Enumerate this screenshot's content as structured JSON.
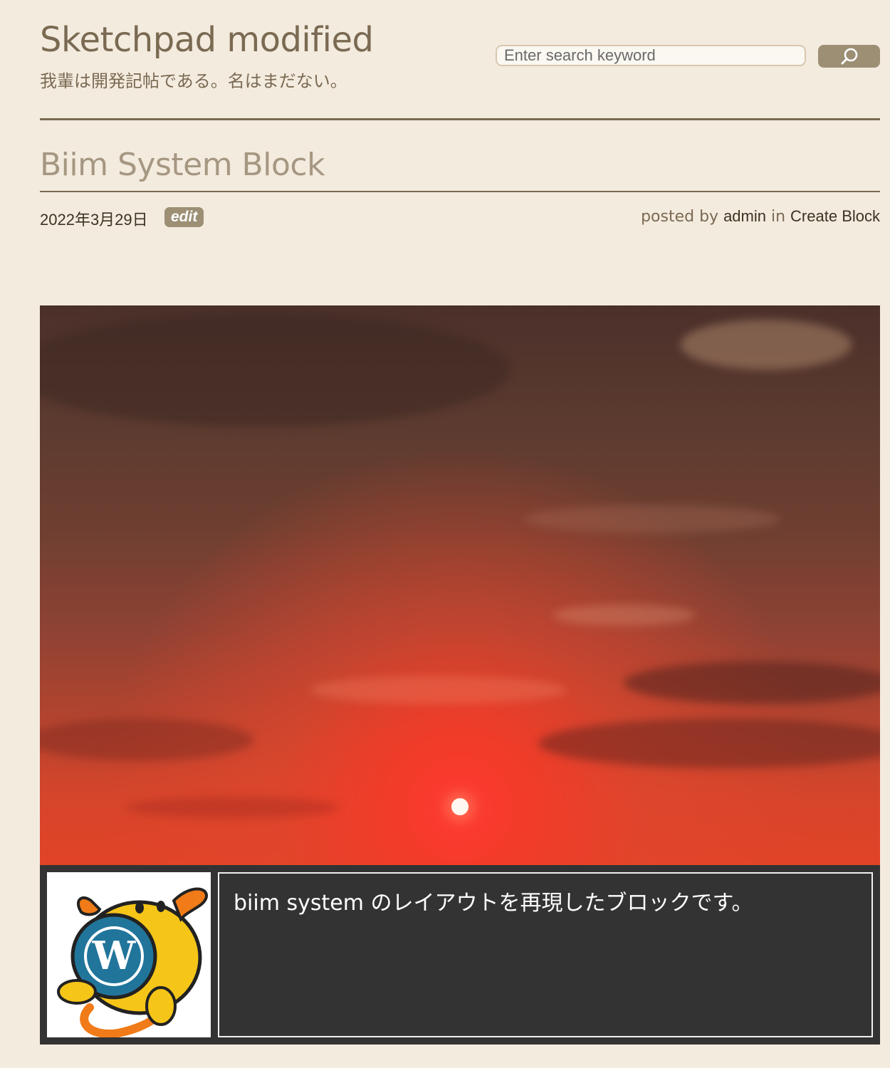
{
  "site": {
    "title": "Sketchpad modified",
    "tagline": "我輩は開発記帖である。名はまだない。"
  },
  "search": {
    "placeholder": "Enter search keyword",
    "button_icon": "search-icon"
  },
  "post": {
    "title": "Biim System Block",
    "date": "2022年3月29日",
    "edit_label": "edit",
    "posted_by_label": "posted by",
    "author": "admin",
    "in_label": "in",
    "category": "Create Block"
  },
  "block": {
    "hero_image": "sunset-sky",
    "avatar_image": "wapuu-wordpress-mascot",
    "description": "biim system のレイアウトを再現したブロックです。"
  },
  "colors": {
    "background": "#f4ebdf",
    "accent": "#9c8f74",
    "panel": "#333333"
  }
}
